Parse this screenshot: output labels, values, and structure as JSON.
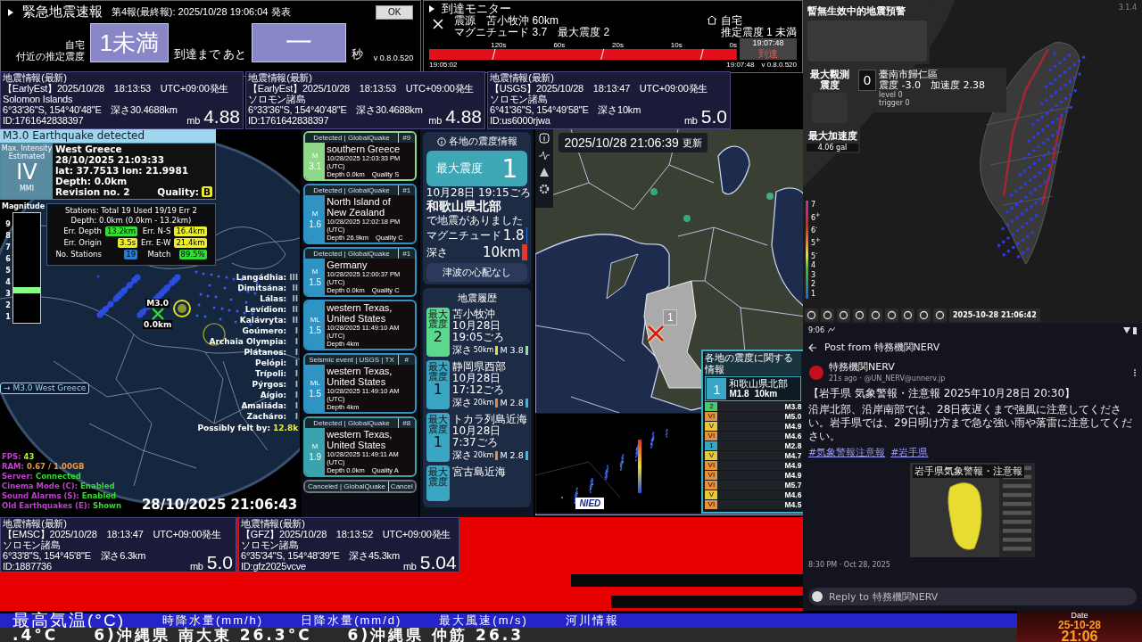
{
  "eew": {
    "title": "緊急地震速報",
    "report": "第4報(最終報): 2025/10/28 19:06:04 発表",
    "ok_button": "OK",
    "location_label": "自宅",
    "intensity_label": "付近の推定震度",
    "intensity": "1未満",
    "arrival_label": "到達まで あと",
    "countdown": "一",
    "unit": "秒",
    "version": "v 0.8.0.520"
  },
  "arrival_monitor": {
    "title": "到達モニター",
    "epicenter": "震源　苫小牧沖 60km",
    "magnitude": "マグニチュード 3.7　最大震度 2",
    "home_label": "自宅",
    "home_intensity": "推定震度 1 未満",
    "ticks": [
      "120s",
      "60s",
      "20s",
      "10s",
      "0s"
    ],
    "arrival_time": "19:07:48",
    "arrival_label": "到達",
    "start_time": "19:05:02",
    "end_time": "19:07:48",
    "version": "v 0.8.0.520"
  },
  "quake_info_top": [
    {
      "header": "地震情報(最新)",
      "source": "【EarlyEst】2025/10/28　18:13:53　UTC+09:00発生",
      "region": "Solomon Islands",
      "coords": "6°33'36\"S, 154°40'48\"E　深さ30.4688km",
      "id": "ID:1761642838397",
      "mag_type": "mb",
      "magnitude": "4.88"
    },
    {
      "header": "地震情報(最新)",
      "source": "【EarlyEst】2025/10/28　18:13:53　UTC+09:00発生",
      "region": "ソロモン諸島",
      "coords": "6°33'36\"S, 154°40'48\"E　深さ30.4688km",
      "id": "ID:1761642838397",
      "mag_type": "mb",
      "magnitude": "4.88"
    },
    {
      "header": "地震情報(最新)",
      "source": "【USGS】2025/10/28　18:13:47　UTC+09:00発生",
      "region": "ソロモン諸島",
      "coords": "6°41'36\"S, 154°49'58\"E　深さ10km",
      "id": "ID:us6000rjwa",
      "mag_type": "mb",
      "magnitude": "5.0"
    }
  ],
  "globe": {
    "alert_title": "M3.0 Earthquake detected",
    "intensity_caption": "Max. Intensity",
    "intensity_note": "Estimated",
    "intensity": "IV",
    "intensity_scale": "MMI",
    "region": "West Greece",
    "time": "28/10/2025 21:03:33",
    "location": "lat: 37.7513 lon: 21.9981",
    "depth": "Depth: 0.0km",
    "revision": "Revision no. 2",
    "quality_label": "Quality:",
    "quality": "B",
    "magnitude_meter": {
      "label": "Magnitude",
      "ticks": [
        "9",
        "8",
        "7",
        "6",
        "5",
        "4",
        "3",
        "2",
        "1"
      ],
      "level": 0.33
    },
    "stations": "Stations: Total 19 Used 19/19 Err 2",
    "depth_range": "Depth: 0.0km (0.0km - 13.2km)",
    "stats": [
      {
        "label": "Err. Depth",
        "value": "13.2km",
        "color": "#33dd33"
      },
      {
        "label": "Err. N-S",
        "value": "16.4km",
        "color": "#eeee22"
      },
      {
        "label": "Err. Origin",
        "value": "3.5s",
        "color": "#eeee22"
      },
      {
        "label": "Err. E-W",
        "value": "21.4km",
        "color": "#eeee22"
      },
      {
        "label": "No. Stations",
        "value": "19",
        "color": "#2a7fd4"
      },
      {
        "label": "Match",
        "value": "89.5%",
        "color": "#33dd33"
      }
    ],
    "marker_label": "M3.0",
    "marker_depth": "0.0km",
    "felt": [
      {
        "place": "Langádhia:",
        "level": "III"
      },
      {
        "place": "Dimitsána:",
        "level": "II"
      },
      {
        "place": "Lálas:",
        "level": "II"
      },
      {
        "place": "Levídion:",
        "level": "II"
      },
      {
        "place": "Kalávryta:",
        "level": "II"
      },
      {
        "place": "Goúmero:",
        "level": "I"
      },
      {
        "place": "Archaia Olympia:",
        "level": "I"
      },
      {
        "place": "Plátanos:",
        "level": "I"
      },
      {
        "place": "Pelópi:",
        "level": "I"
      },
      {
        "place": "Trípoli:",
        "level": "I"
      },
      {
        "place": "Pýrgos:",
        "level": "I"
      },
      {
        "place": "Aígio:",
        "level": "I"
      },
      {
        "place": "Amaliáda:",
        "level": "I"
      },
      {
        "place": "Zacháro:",
        "level": "I"
      }
    ],
    "felt_by_label": "Possibly felt by:",
    "felt_by": "12.8k",
    "list_entry": "→ M3.0 West Greece",
    "status": [
      {
        "label": "FPS:",
        "value": "43",
        "color": "#bbee33"
      },
      {
        "label": "RAM:",
        "value": "0.67 / 1.00GB",
        "color": "#ee9933"
      },
      {
        "label": "Server:",
        "value": "Connected",
        "color": "#33dd33"
      },
      {
        "label": "Cinema Mode (C):",
        "value": "Enabled",
        "color": "#33dd33"
      },
      {
        "label": "Sound Alarms (S):",
        "value": "Enabled",
        "color": "#33dd33"
      },
      {
        "label": "Old Earthquakes (E):",
        "value": "Shown",
        "color": "#33dd33"
      }
    ],
    "clock": "28/10/2025 21:06:43"
  },
  "events": [
    {
      "status": "Detected | GlobalQuake",
      "number": "#9",
      "mag_type": "M",
      "magnitude": "3.1",
      "region": "southern Greece",
      "time": "10/28/2025 12:03:33 PM (UTC)",
      "details": "Depth 0.0km　Quality S",
      "color": "#8fd88a"
    },
    {
      "status": "Detected | GlobalQuake",
      "number": "#1",
      "mag_type": "M",
      "magnitude": "1.6",
      "region": "North Island of New Zealand",
      "time": "10/28/2025 12:02:18 PM (UTC)",
      "details": "Depth 26.9km　Quality C",
      "color": "#2f93c4"
    },
    {
      "status": "Detected | GlobalQuake",
      "number": "#1",
      "mag_type": "M",
      "magnitude": "1.5",
      "region": "Germany",
      "time": "10/28/2025 12:00:37 PM (UTC)",
      "details": "Depth 0.0km　Quality C",
      "color": "#2f93c4"
    },
    {
      "mag_type": "ML",
      "magnitude": "1.5",
      "region": "western Texas, United States",
      "time": "10/28/2025 11:49:10 AM (UTC)",
      "details": "Depth 4km",
      "color": "#2f93c4"
    },
    {
      "status": "Seismic event | USGS | TX",
      "number": "#",
      "mag_type": "ML",
      "magnitude": "1.5",
      "region": "western Texas, United States",
      "time": "10/28/2025 11:49:10 AM (UTC)",
      "details": "Depth 4km",
      "color": "#2f93c4"
    },
    {
      "status": "Detected | GlobalQuake",
      "number": "#8",
      "mag_type": "M",
      "magnitude": "1.9",
      "region": "western Texas, United States",
      "time": "10/28/2025 11:49:11 AM (UTC)",
      "details": "Depth 0.0km　Quality A",
      "color": "#3aa3ad"
    },
    {
      "status": "Canceled | GlobalQuake",
      "number": "Cancel",
      "color": "#777777"
    }
  ],
  "shindo": {
    "title": "各地の震度情報",
    "max_label": "最大震度",
    "max_value": "1",
    "time": "10月28日 19:15ごろ",
    "region": "和歌山県北部",
    "note": "で地震がありました",
    "magnitude_label": "マグニチュード",
    "magnitude": {
      "value": "1.8",
      "color": "#2f6fe0"
    },
    "depth_label": "深さ",
    "depth": {
      "value": "10km",
      "color": "#e03a2a"
    },
    "tsunami": "津波の心配なし",
    "history_title": "地震履歴",
    "history": [
      {
        "intensity_label": "最大震度",
        "intensity": "2",
        "color": "#5ad98e",
        "region": "苫小牧沖",
        "time": "10月28日 19:05ごろ",
        "depth_label": "深さ",
        "depth": {
          "value": "50km",
          "color": "#e8d83a"
        },
        "magnitude": {
          "value": "M 3.8",
          "color": "#8fe08a"
        }
      },
      {
        "intensity_label": "最大震度",
        "intensity": "1",
        "color": "#3aa6c4",
        "region": "静岡県西部",
        "time": "10月28日 17:12ごろ",
        "depth_label": "深さ",
        "depth": {
          "value": "20km",
          "color": "#e8883a"
        },
        "magnitude": {
          "value": "M 2.8",
          "color": "#3ab8e0"
        }
      },
      {
        "intensity_label": "最大震度",
        "intensity": "1",
        "color": "#3aa6c4",
        "region": "トカラ列島近海",
        "time": "10月28日 7:37ごろ",
        "depth_label": "深さ",
        "depth": {
          "value": "20km",
          "color": "#e8883a"
        },
        "magnitude": {
          "value": "M 2.8",
          "color": "#3ab8e0"
        }
      },
      {
        "intensity_label": "最大震度",
        "color": "#3aa6c4",
        "region": "宮古島近海"
      }
    ]
  },
  "map": {
    "timestamp": "2025/10/28 21:06:39",
    "updated": "更新",
    "marker_intensity": "1",
    "inset_logo": "NIED",
    "info_title": "各地の震度に関する情報",
    "info_intensity": "1",
    "info_region": "和歌山県北部",
    "info_magnitude": "M1.8",
    "info_depth": "10km",
    "quakes": [
      {
        "intensity": "2",
        "magnitude": "M3.8",
        "color": "#4cc870"
      },
      {
        "intensity": "VI",
        "magnitude": "M5.0",
        "color": "#e8903a"
      },
      {
        "intensity": "V",
        "magnitude": "M4.9",
        "color": "#e8c83a"
      },
      {
        "intensity": "VI",
        "magnitude": "M4.6",
        "color": "#e8903a"
      },
      {
        "intensity": "1",
        "magnitude": "M2.8",
        "color": "#3aa6c4"
      },
      {
        "intensity": "V",
        "magnitude": "M4.7",
        "color": "#e8c83a"
      },
      {
        "intensity": "VI",
        "magnitude": "M4.9",
        "color": "#e8903a"
      },
      {
        "intensity": "VI",
        "magnitude": "M4.9",
        "color": "#e8903a"
      },
      {
        "intensity": "VI",
        "magnitude": "M5.7",
        "color": "#e8903a"
      },
      {
        "intensity": "V",
        "magnitude": "M4.6",
        "color": "#e8c83a"
      },
      {
        "intensity": "VI",
        "magnitude": "M4.5",
        "color": "#e8903a"
      }
    ]
  },
  "quake_info_bottom": [
    {
      "header": "地震情報(最新)",
      "source": "【EMSC】2025/10/28　18:13:47　UTC+09:00発生",
      "region": "ソロモン諸島",
      "coords": "6°33'8\"S, 154°45'8\"E　深さ6.3km",
      "id": "ID:1887736",
      "mag_type": "mb",
      "magnitude": "5.0"
    },
    {
      "header": "地震情報(最新)",
      "source": "【GFZ】2025/10/28　18:13:52　UTC+09:00発生",
      "region": "ソロモン諸島",
      "coords": "6°35'34\"S, 154°48'39\"E　深さ45.3km",
      "id": "ID:gfz2025vcve",
      "mag_type": "mb",
      "magnitude": "5.04"
    }
  ],
  "taiwan": {
    "version": "3.1.4",
    "warning_title": "暫無生效中的地震預警",
    "max_intensity_label": "最大觀測震度",
    "station_intensity": "0",
    "station_name": "臺南市歸仁區",
    "station_reading": "震度 -3.0　加速度 2.38",
    "level": "level 0",
    "trigger": "trigger 0",
    "max_accel_label": "最大加速度",
    "max_accel": "4.06 gal",
    "scale": [
      "7",
      "6$^{+}$",
      "6$^{-}$",
      "5$^{+}$",
      "5$^{-}$",
      "4",
      "3",
      "2",
      "1"
    ],
    "timestamp": "2025-10-28 21:06:42"
  },
  "nerv": {
    "clock": "9:06",
    "title": "Post from 特務機関NERV",
    "author": "特務機関NERV",
    "meta": "21s ago · @UN_NERV@unnerv.jp",
    "headline": "【岩手県 気象警報・注意報 2025年10月28日 20:30】",
    "body": "沿岸北部、沿岸南部では、28日夜遅くまで強風に注意してください。岩手県では、29日明け方まで急な強い雨や落雷に注意してください。",
    "hashtags": [
      "#気象警報注意報",
      "#岩手県"
    ],
    "image_title": "岩手県気象警報・注意報",
    "posted": "8:30 PM · Oct 28, 2025",
    "reply_placeholder": "Reply to 特務機関NERV"
  },
  "ticker": {
    "headers": [
      "最高気温(°C)",
      "時降水量(mm/h)",
      "日降水量(mm/d)",
      "最大風速(m/s)",
      "河川情報"
    ],
    "line": ".4°C　　6)沖縄県 南大東 26.3°C　　6)沖縄県 仲筋 26.3",
    "date_label": "Date",
    "date": "25-10-28",
    "time": "21:06"
  }
}
